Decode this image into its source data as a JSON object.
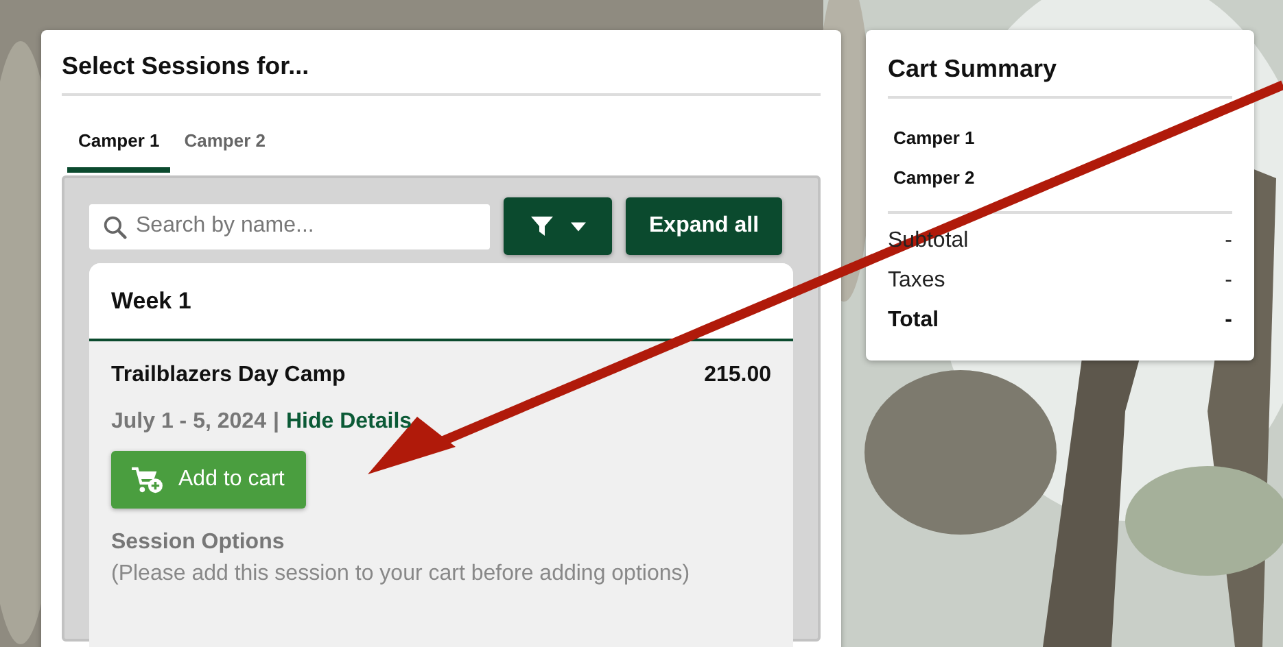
{
  "sessions_panel": {
    "title": "Select Sessions for...",
    "tabs": [
      {
        "label": "Camper 1",
        "selected": true
      },
      {
        "label": "Camper 2",
        "selected": false
      }
    ],
    "search": {
      "placeholder": "Search by name..."
    },
    "expand_button": "Expand all",
    "week": {
      "title": "Week 1",
      "session": {
        "name": "Trailblazers Day Camp",
        "price": "215.00",
        "dates": "July 1 - 5, 2024",
        "separator": "|",
        "details_link": "Hide Details",
        "add_button": "Add to cart",
        "options_title": "Session Options",
        "options_note": "(Please add this session to your cart before adding options)"
      }
    }
  },
  "cart_summary": {
    "title": "Cart Summary",
    "campers": [
      "Camper 1",
      "Camper 2"
    ],
    "totals": [
      {
        "kind": "normal",
        "label": "Subtotal",
        "value": "-"
      },
      {
        "kind": "normal",
        "label": "Taxes",
        "value": "-"
      },
      {
        "kind": "total",
        "label": "Total",
        "value": "-"
      }
    ]
  }
}
